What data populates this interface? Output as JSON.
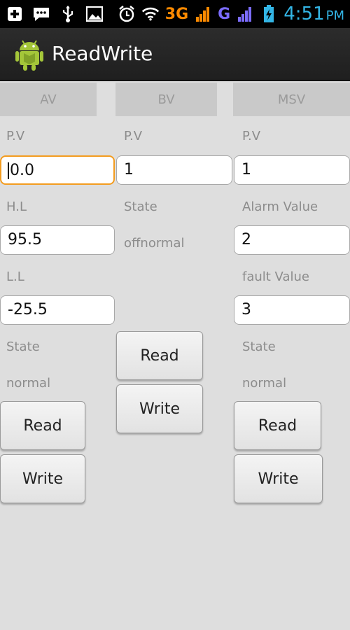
{
  "status_bar": {
    "icons_left": [
      "add-icon",
      "chat-icon",
      "usb-icon",
      "image-icon"
    ],
    "icons_right": [
      "alarm-icon",
      "wifi-icon",
      "signal-3g-icon",
      "signal-g-icon",
      "battery-charging-icon"
    ],
    "network_1": "3G",
    "network_2": "G",
    "time": "4:51",
    "ampm": "PM"
  },
  "action_bar": {
    "title": "ReadWrite"
  },
  "tabs": [
    {
      "label": "AV"
    },
    {
      "label": "BV"
    },
    {
      "label": "MSV"
    }
  ],
  "av": {
    "pv_label": "P.V",
    "pv_value": "0.0",
    "hl_label": "H.L",
    "hl_value": "95.5",
    "ll_label": "L.L",
    "ll_value": "-25.5",
    "state_label": "State",
    "state_value": "normal",
    "read_label": "Read",
    "write_label": "Write"
  },
  "bv": {
    "pv_label": "P.V",
    "pv_value": "1",
    "state_label": "State",
    "state_value": "offnormal",
    "read_label": "Read",
    "write_label": "Write"
  },
  "msv": {
    "pv_label": "P.V",
    "pv_value": "1",
    "alarm_label": "Alarm Value",
    "alarm_value": "2",
    "fault_label": "fault Value",
    "fault_value": "3",
    "state_label": "State",
    "state_value": "normal",
    "read_label": "Read",
    "write_label": "Write"
  },
  "colors": {
    "status_bar_bg": "#000000",
    "action_bar_bg": "#262626",
    "focus_border": "#f39c1f",
    "time_text": "#33b5e5"
  }
}
